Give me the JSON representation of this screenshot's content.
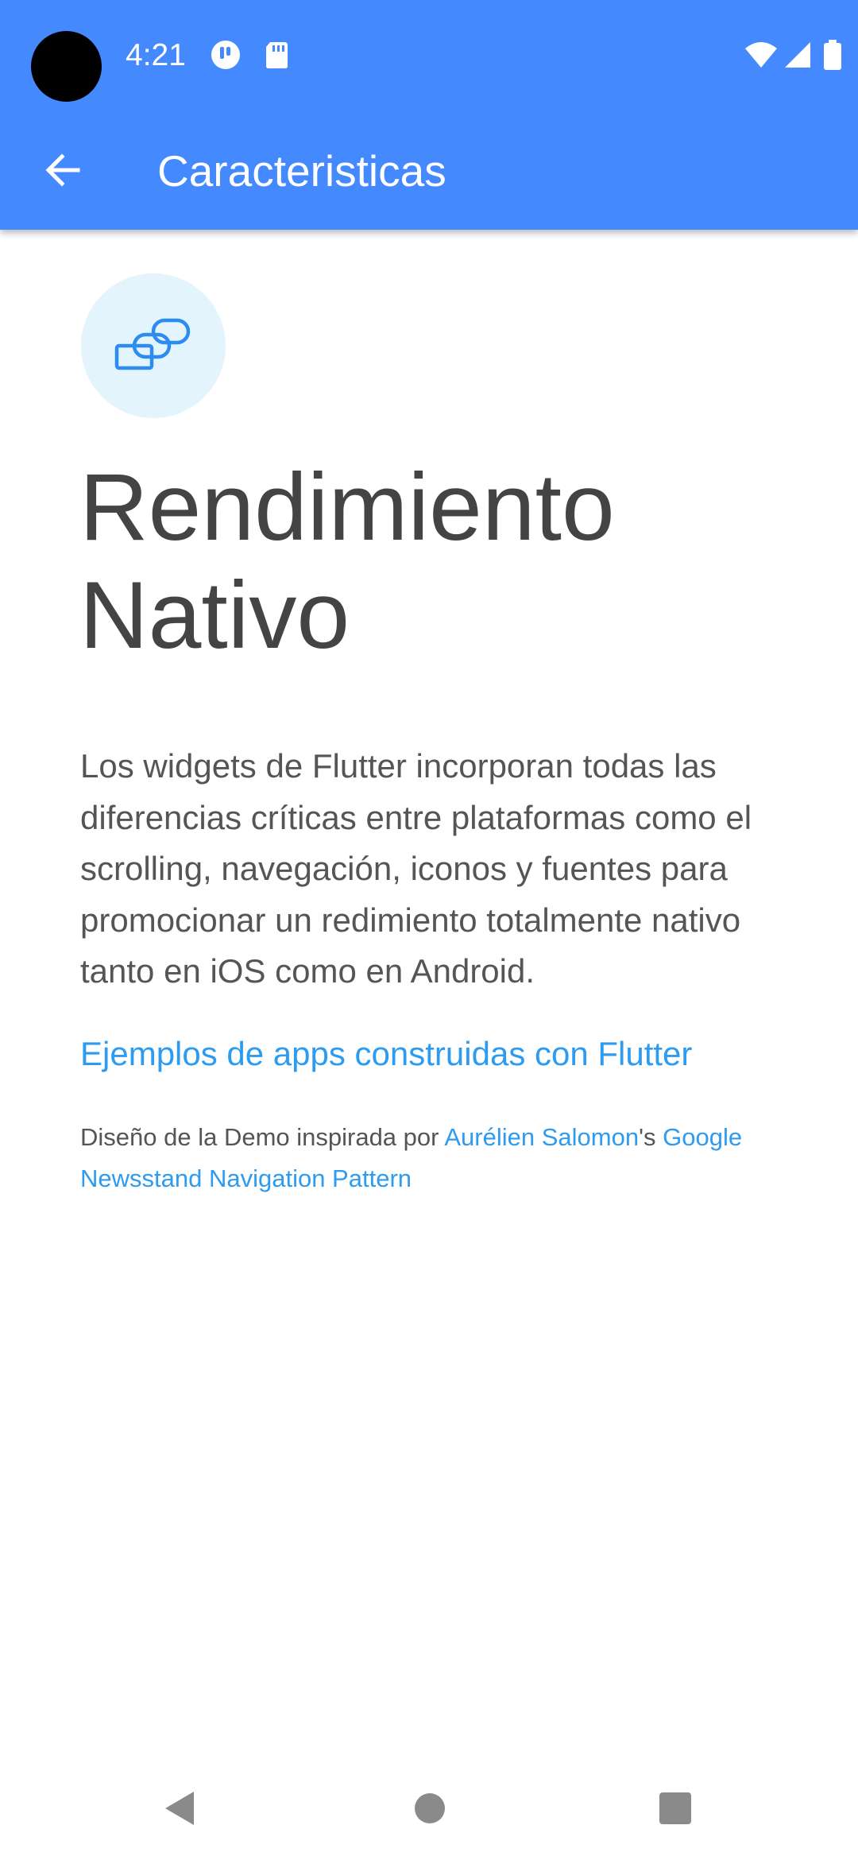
{
  "status_bar": {
    "time": "4:21",
    "left_icons": [
      "notification-app-icon",
      "sd-card-icon"
    ],
    "right_icons": [
      "wifi-icon",
      "cell-signal-icon",
      "battery-icon"
    ]
  },
  "app_bar": {
    "back_icon": "arrow-back-icon",
    "title": "Caracteristicas"
  },
  "feature": {
    "icon": "windows-stack-icon",
    "icon_bg_color": "#e3f4fd",
    "icon_color": "#2d8cf0",
    "title_line1": "Rendimiento",
    "title_line2": "Nativo",
    "description": "Los widgets de Flutter incorporan todas las diferencias críticas entre plataformas como el scrolling, navegación, iconos y fuentes para promocionar un redimiento totalmente nativo tanto en iOS como en Android.",
    "examples_link": "Ejemplos de apps construidas con Flutter"
  },
  "credits": {
    "prefix": "Diseño de la Demo inspirada por ",
    "author_link": "Aurélien Salomon",
    "possessive": "'s ",
    "pattern_link": "Google Newsstand Navigation Pattern"
  },
  "nav_bar": {
    "buttons": [
      "back-triangle-icon",
      "home-circle-icon",
      "recents-square-icon"
    ]
  },
  "colors": {
    "primary": "#4489fe",
    "link": "#2d9bf0",
    "headline": "#444444",
    "body_text": "#555555"
  }
}
